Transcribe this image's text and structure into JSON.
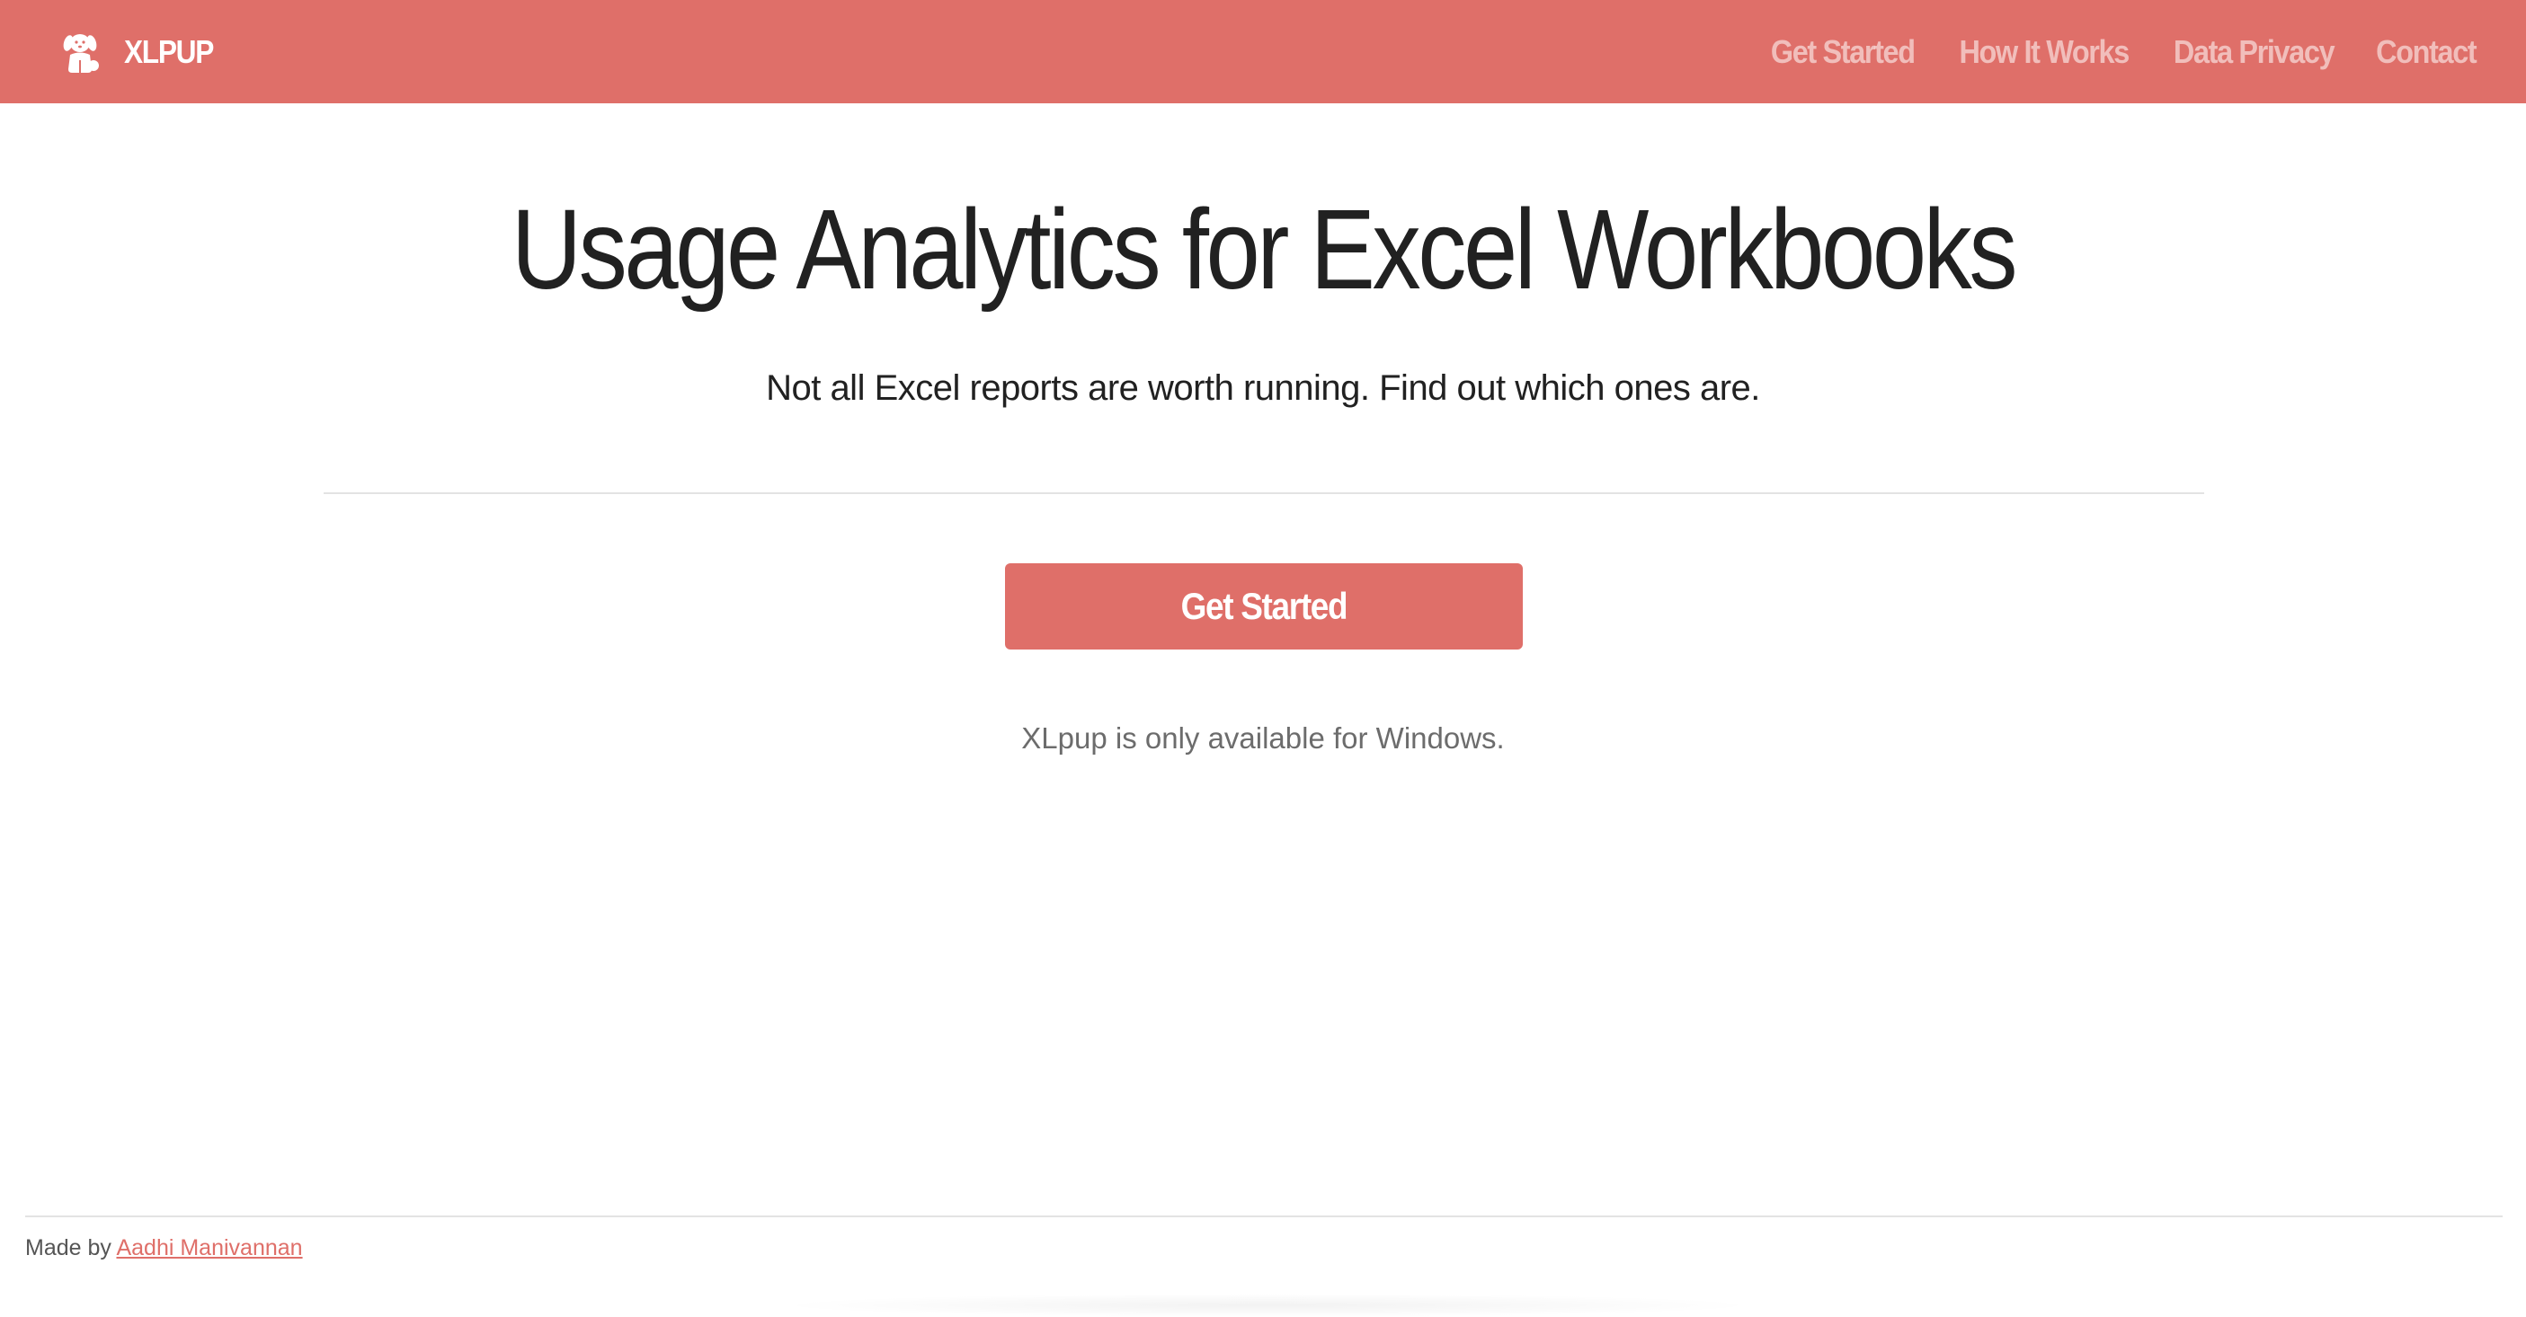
{
  "navbar": {
    "brand": "XLPUP",
    "logo_icon": "puppy-icon",
    "links": [
      {
        "label": "Get Started"
      },
      {
        "label": "How It Works"
      },
      {
        "label": "Data Privacy"
      },
      {
        "label": "Contact"
      }
    ]
  },
  "hero": {
    "title": "Usage Analytics for Excel Workbooks",
    "subtitle": "Not all Excel reports are worth running. Find out which ones are.",
    "cta_label": "Get Started",
    "availability": "XLpup is only available for Windows."
  },
  "footer": {
    "made_by_prefix": "Made by",
    "author": "Aadhi Manivannan"
  },
  "colors": {
    "accent": "#df6f69",
    "text": "#212121",
    "muted": "#6c6c6c"
  }
}
